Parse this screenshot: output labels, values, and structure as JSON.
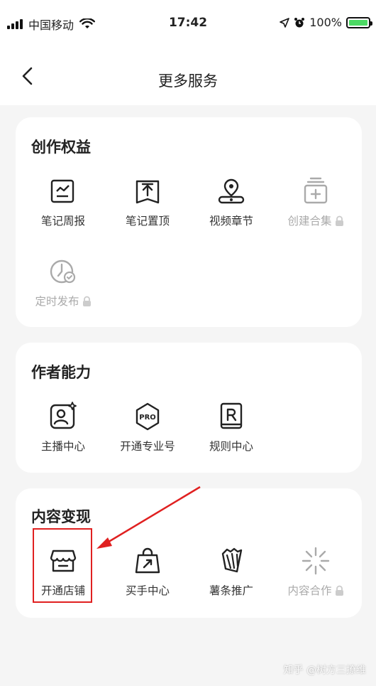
{
  "status_bar": {
    "carrier": "中国移动",
    "time": "17:42",
    "battery": "100%"
  },
  "nav": {
    "title": "更多服务",
    "back_icon": "chevron-left-icon"
  },
  "sections": [
    {
      "title": "创作权益",
      "items": [
        {
          "label": "笔记周报",
          "icon": "note-report-icon",
          "locked": false
        },
        {
          "label": "笔记置顶",
          "icon": "pin-top-icon",
          "locked": false
        },
        {
          "label": "视频章节",
          "icon": "video-chapter-icon",
          "locked": false
        },
        {
          "label": "创建合集",
          "icon": "collection-add-icon",
          "locked": true
        },
        {
          "label": "定时发布",
          "icon": "scheduled-publish-icon",
          "locked": true
        }
      ]
    },
    {
      "title": "作者能力",
      "items": [
        {
          "label": "主播中心",
          "icon": "host-center-icon",
          "locked": false
        },
        {
          "label": "开通专业号",
          "icon": "pro-badge-icon",
          "locked": false
        },
        {
          "label": "规则中心",
          "icon": "rules-icon",
          "locked": false
        }
      ]
    },
    {
      "title": "内容变现",
      "items": [
        {
          "label": "开通店铺",
          "icon": "shop-icon",
          "locked": false
        },
        {
          "label": "买手中心",
          "icon": "shopping-bag-icon",
          "locked": false
        },
        {
          "label": "薯条推广",
          "icon": "fries-promo-icon",
          "locked": false
        },
        {
          "label": "内容合作",
          "icon": "sparkle-icon",
          "locked": true
        }
      ]
    }
  ],
  "watermark": "知乎 @树方三撩维"
}
